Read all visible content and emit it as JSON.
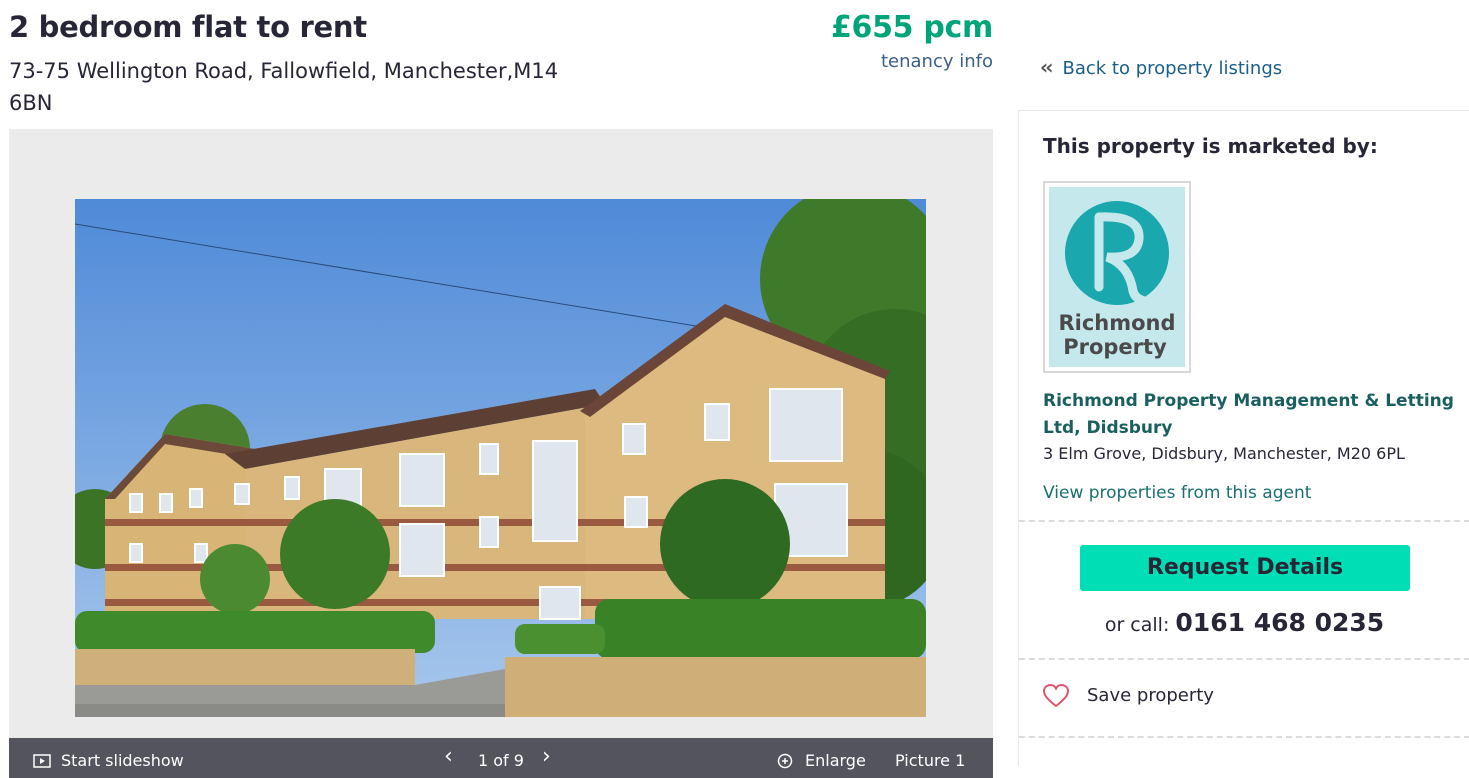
{
  "header": {
    "title": "2 bedroom flat to rent",
    "address": "73-75 Wellington Road, Fallowfield, Manchester,M14 6BN",
    "price": "£655 pcm",
    "tenancy_link": "tenancy info"
  },
  "back_link": "Back to property listings",
  "gallery": {
    "slideshow_label": "Start slideshow",
    "counter": "1 of 9",
    "enlarge_label": "Enlarge",
    "picture_label": "Picture 1"
  },
  "agent": {
    "heading": "This property is marketed by:",
    "logo_text_line1": "Richmond",
    "logo_text_line2": "Property",
    "name": "Richmond Property Management & Letting Ltd, Didsbury",
    "address": "3 Elm Grove, Didsbury, Manchester, M20 6PL",
    "view_properties": "View properties from this agent",
    "request_button": "Request Details",
    "or_call": "or call:",
    "phone": "0161 468 0235",
    "save_property": "Save property"
  },
  "colors": {
    "price_green": "#00a479",
    "button_teal": "#00deb6",
    "link_blue": "#1a5f8a",
    "logo_teal": "#1aa7ad",
    "logo_bg": "#c5e8ec",
    "heart_red": "#e0556b"
  },
  "icons": [
    "double-chevron-left-icon",
    "play-icon",
    "chevron-left-icon",
    "chevron-right-icon",
    "zoom-icon",
    "heart-icon"
  ]
}
